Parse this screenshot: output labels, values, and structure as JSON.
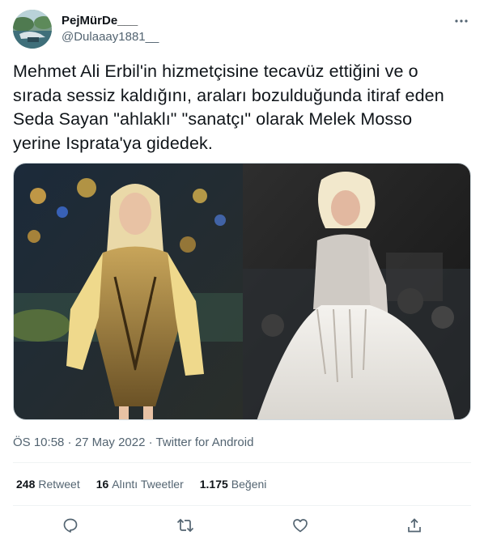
{
  "user": {
    "display_name": "PejMürDe___",
    "handle": "@Dulaaay1881__"
  },
  "tweet": {
    "text": "Mehmet Ali Erbil'in hizmetçisine tecavüz ettiğini ve o\nsırada sessiz kaldığını, araları bozulduğunda itiraf eden\nSeda Sayan \"ahlaklı\" \"sanatçı\" olarak Melek Mosso\nyerine Isprata'ya gidedek."
  },
  "meta": {
    "time": "ÖS 10:58",
    "sep1": " · ",
    "date": "27 May 2022",
    "sep2": " · ",
    "source": "Twitter for Android"
  },
  "stats": {
    "retweets_count": "248",
    "retweets_label": "Retweet",
    "quotes_count": "16",
    "quotes_label": "Alıntı Tweetler",
    "likes_count": "1.175",
    "likes_label": "Beğeni"
  },
  "icons": {
    "more": "more-horizontal-icon",
    "reply": "reply-icon",
    "retweet": "retweet-icon",
    "like": "heart-icon",
    "share": "share-icon"
  },
  "colors": {
    "text_primary": "#0f1419",
    "text_secondary": "#536471",
    "divider": "#eff3f4"
  }
}
